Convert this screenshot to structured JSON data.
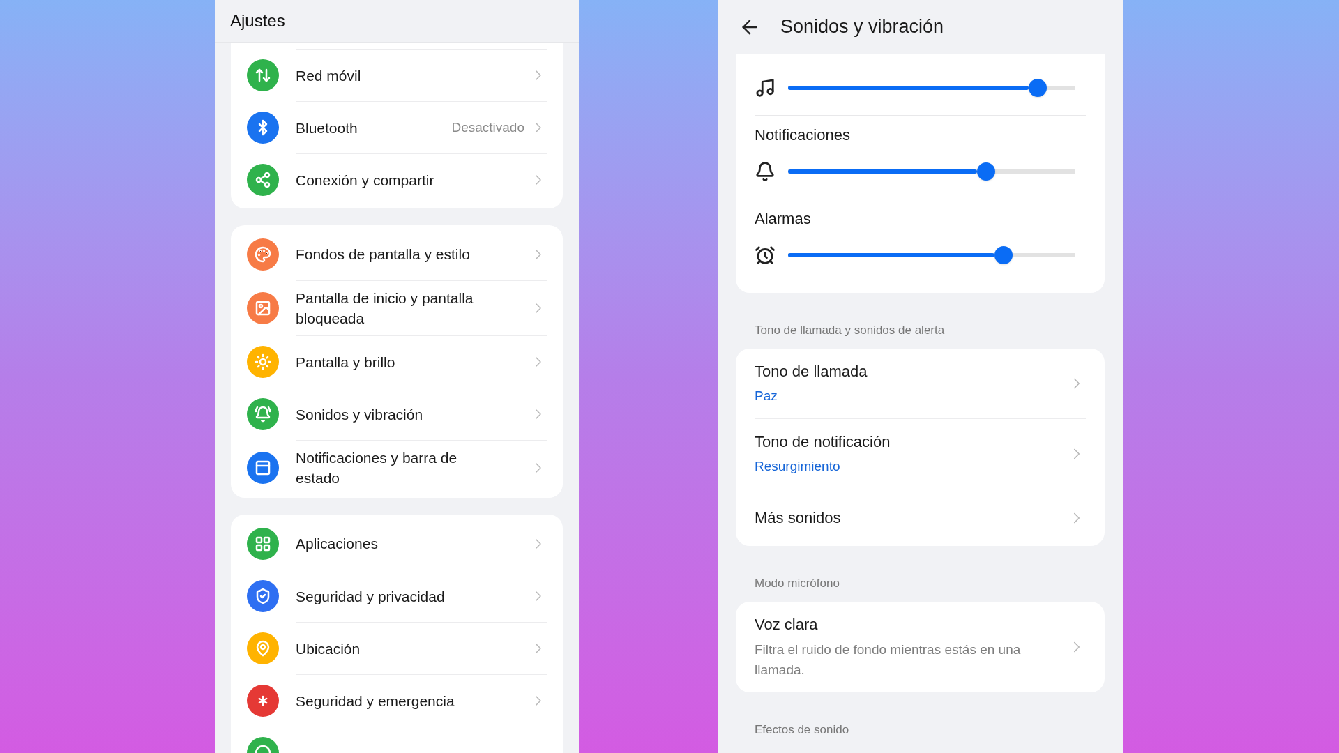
{
  "settings_screen": {
    "title": "Ajustes",
    "groups": [
      {
        "items": [
          {
            "label": "Red móvil",
            "color": "#2fb24c"
          },
          {
            "label": "Bluetooth",
            "value": "Desactivado",
            "color": "#1a73f0"
          },
          {
            "label": "Conexión y compartir",
            "color": "#2fb24c"
          }
        ]
      },
      {
        "items": [
          {
            "label": "Fondos de pantalla y estilo",
            "color": "#f77b46"
          },
          {
            "label": "Pantalla de inicio y pantalla bloqueada",
            "color": "#f77b46"
          },
          {
            "label": "Pantalla y brillo",
            "color": "#ffb300"
          },
          {
            "label": "Sonidos y vibración",
            "color": "#2fb24c"
          },
          {
            "label": "Notificaciones y barra de estado",
            "color": "#1a73f0"
          }
        ]
      },
      {
        "items": [
          {
            "label": "Aplicaciones",
            "color": "#2fb24c"
          },
          {
            "label": "Seguridad y privacidad",
            "color": "#2e6ff2"
          },
          {
            "label": "Ubicación",
            "color": "#ffb300"
          },
          {
            "label": "Seguridad y emergencia",
            "color": "#e53935"
          },
          {
            "color": "#2fb24c"
          }
        ]
      }
    ]
  },
  "sound_screen": {
    "title": "Sonidos y vibración",
    "volume_sliders": [
      {
        "level": 0.87
      },
      {
        "label": "Notificaciones",
        "level": 0.69
      },
      {
        "label": "Alarmas",
        "level": 0.75
      }
    ],
    "sections": [
      {
        "header": "Tono de llamada y sonidos de alerta",
        "items": [
          {
            "title": "Tono de llamada",
            "value": "Paz"
          },
          {
            "title": "Tono de notificación",
            "value": "Resurgimiento"
          },
          {
            "title": "Más sonidos"
          }
        ]
      },
      {
        "header": "Modo micrófono",
        "items": [
          {
            "title": "Voz clara",
            "description": "Filtra el ruido de fondo mientras estás en una llamada."
          }
        ]
      },
      {
        "header": "Efectos de sonido"
      }
    ]
  }
}
